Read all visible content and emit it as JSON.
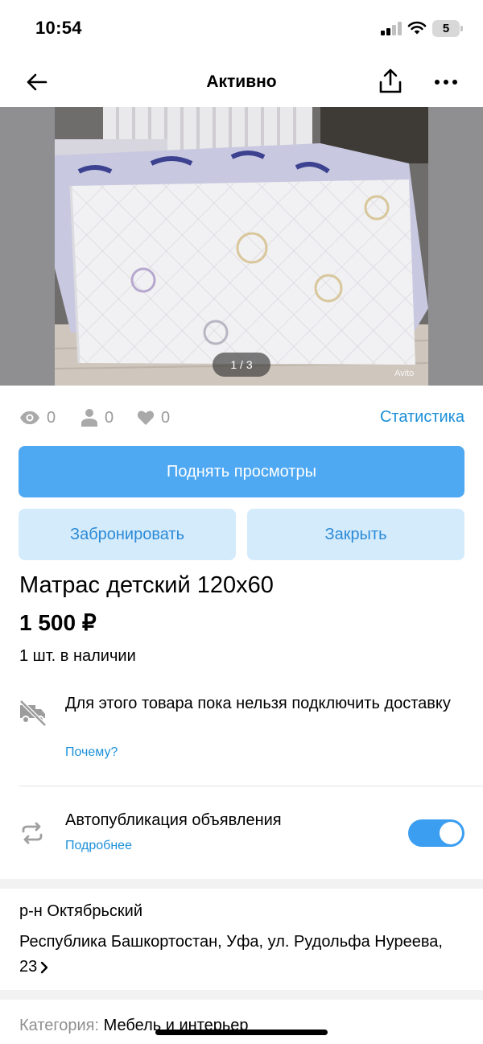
{
  "status_bar": {
    "time": "10:54",
    "battery": "5"
  },
  "nav": {
    "title": "Активно"
  },
  "gallery": {
    "counter": "1 / 3",
    "watermark": "Avito"
  },
  "stats": {
    "views": "0",
    "contacts": "0",
    "favorites": "0",
    "link": "Статистика"
  },
  "actions": {
    "promote": "Поднять просмотры",
    "reserve": "Забронировать",
    "close": "Закрыть"
  },
  "ad": {
    "title": "Матрас детский 120х60",
    "price": "1 500 ₽",
    "stock": "1 шт. в наличии"
  },
  "delivery": {
    "text": "Для этого товара пока нельзя подключить доставку",
    "link": "Почему?"
  },
  "autopublish": {
    "title": "Автопубликация объявления",
    "link": "Подробнее",
    "enabled": true
  },
  "location": {
    "district": "р-н Октябрьский",
    "address": "Республика Башкортостан, Уфа, ул. Рудольфа Нуреева, 23"
  },
  "category": {
    "label": "Категория:",
    "value": "Мебель и интерьер"
  },
  "colors": {
    "accent": "#4ea8f2",
    "link": "#1a8fd8",
    "secondary_bg": "#d4ebfc"
  }
}
